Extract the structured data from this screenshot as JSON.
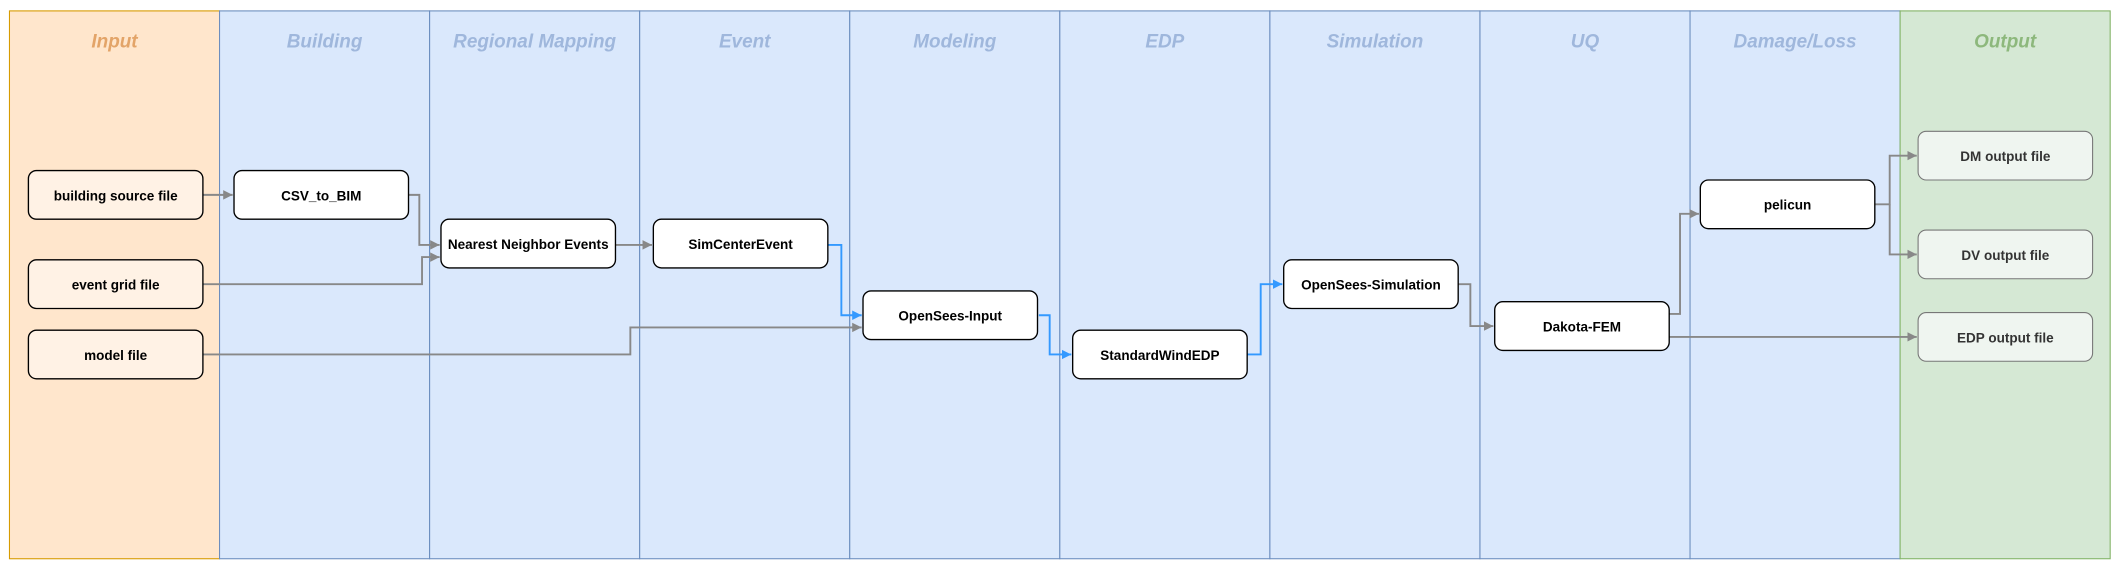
{
  "colors": {
    "input_lane_fill": "#ffe6cc",
    "input_lane_stroke": "#d79b00",
    "input_title": "#e3a468",
    "input_node_fill": "#fff2e5",
    "stage_lane_fill": "#dae8fc",
    "stage_lane_stroke": "#6c8ebf",
    "stage_title": "#9fb7dc",
    "output_lane_fill": "#d5e8d4",
    "output_lane_stroke": "#82b366",
    "output_title": "#8db87c",
    "output_node_fill": "#eff5f0",
    "output_node_stroke": "#777777",
    "edge_gray": "#888888",
    "edge_blue": "#3399ff"
  },
  "lanes": [
    {
      "id": "input",
      "title": "Input"
    },
    {
      "id": "building",
      "title": "Building"
    },
    {
      "id": "regional-mapping",
      "title": "Regional Mapping"
    },
    {
      "id": "event",
      "title": "Event"
    },
    {
      "id": "modeling",
      "title": "Modeling"
    },
    {
      "id": "edp",
      "title": "EDP"
    },
    {
      "id": "simulation",
      "title": "Simulation"
    },
    {
      "id": "uq",
      "title": "UQ"
    },
    {
      "id": "damage-loss",
      "title": "Damage/Loss"
    },
    {
      "id": "output",
      "title": "Output"
    }
  ],
  "nodes": {
    "building_source_file": "building source file",
    "event_grid_file": "event grid file",
    "model_file": "model file",
    "csv_to_bim": "CSV_to_BIM",
    "nearest_neighbor_events": "Nearest Neighbor Events",
    "simcenter_event": "SimCenterEvent",
    "opensees_input": "OpenSees-Input",
    "standard_wind_edp": "StandardWindEDP",
    "opensees_simulation": "OpenSees-Simulation",
    "dakota_fem": "Dakota-FEM",
    "pelicun": "pelicun",
    "dm_output_file": "DM output file",
    "dv_output_file": "DV output file",
    "edp_output_file": "EDP output file"
  },
  "edges": [
    {
      "from": "building_source_file",
      "to": "csv_to_bim",
      "color": "gray"
    },
    {
      "from": "csv_to_bim",
      "to": "nearest_neighbor_events",
      "color": "gray"
    },
    {
      "from": "event_grid_file",
      "to": "nearest_neighbor_events",
      "color": "gray"
    },
    {
      "from": "model_file",
      "to": "opensees_input",
      "color": "gray"
    },
    {
      "from": "nearest_neighbor_events",
      "to": "simcenter_event",
      "color": "gray"
    },
    {
      "from": "simcenter_event",
      "to": "opensees_input",
      "color": "blue"
    },
    {
      "from": "opensees_input",
      "to": "standard_wind_edp",
      "color": "blue"
    },
    {
      "from": "standard_wind_edp",
      "to": "opensees_simulation",
      "color": "blue"
    },
    {
      "from": "opensees_simulation",
      "to": "dakota_fem",
      "color": "gray"
    },
    {
      "from": "dakota_fem",
      "to": "pelicun",
      "color": "gray"
    },
    {
      "from": "dakota_fem",
      "to": "edp_output_file",
      "color": "gray"
    },
    {
      "from": "pelicun",
      "to": "dm_output_file",
      "color": "gray"
    },
    {
      "from": "pelicun",
      "to": "dv_output_file",
      "color": "gray"
    }
  ]
}
